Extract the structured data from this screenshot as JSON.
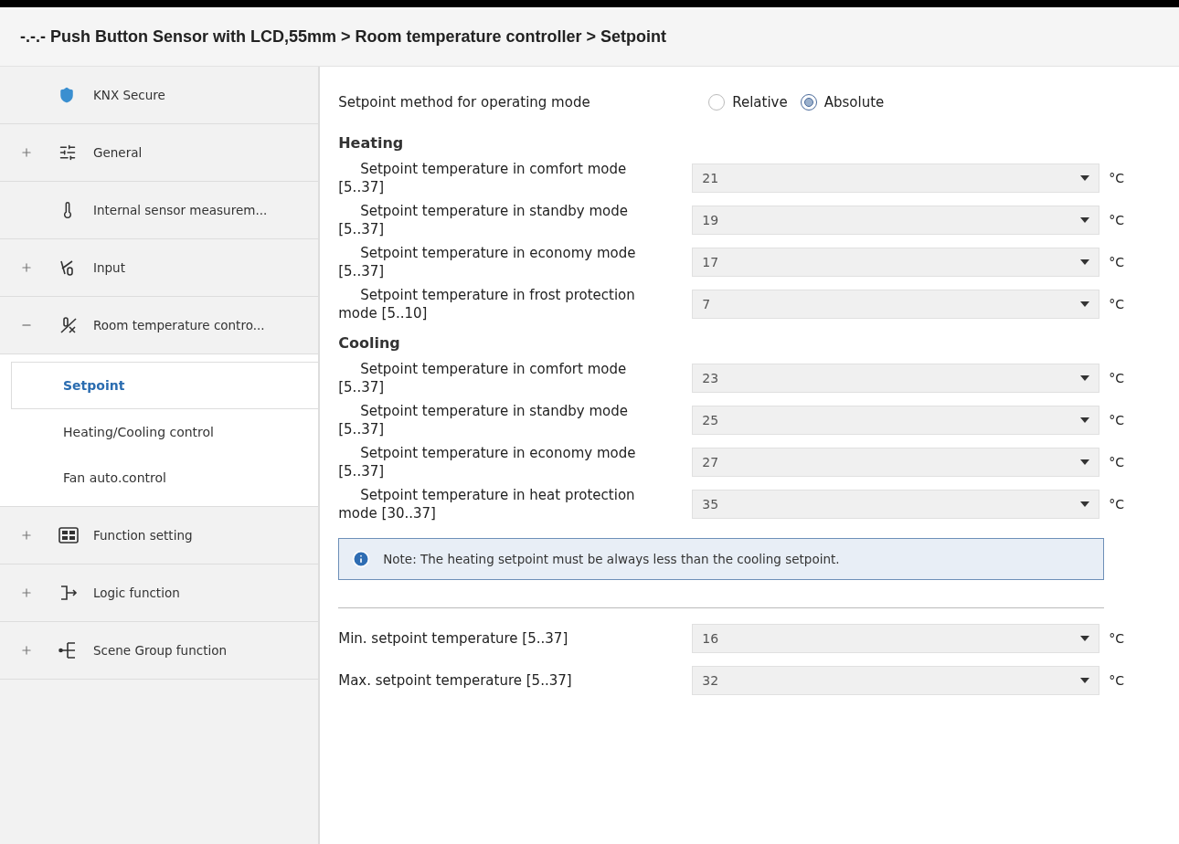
{
  "breadcrumb": "-.-.- Push Button Sensor with LCD,55mm > Room temperature controller > Setpoint",
  "sidebar": {
    "items": [
      {
        "label": "KNX Secure",
        "kind": "leaf"
      },
      {
        "label": "General",
        "kind": "group",
        "expanded": false
      },
      {
        "label": "Internal sensor measurem...",
        "kind": "leaf"
      },
      {
        "label": "Input",
        "kind": "group",
        "expanded": false
      },
      {
        "label": "Room temperature contro...",
        "kind": "group",
        "expanded": true,
        "children": [
          {
            "label": "Setpoint",
            "selected": true
          },
          {
            "label": "Heating/Cooling control",
            "selected": false
          },
          {
            "label": "Fan auto.control",
            "selected": false
          }
        ]
      },
      {
        "label": "Function setting",
        "kind": "group",
        "expanded": false
      },
      {
        "label": "Logic function",
        "kind": "group",
        "expanded": false
      },
      {
        "label": "Scene Group function",
        "kind": "group",
        "expanded": false
      }
    ]
  },
  "method": {
    "label": "Setpoint method for operating mode",
    "options": [
      {
        "label": "Relative",
        "selected": false
      },
      {
        "label": "Absolute",
        "selected": true
      }
    ]
  },
  "sections": [
    {
      "title": "Heating",
      "rows": [
        {
          "label": "Setpoint temperature in comfort mode [5..37]",
          "value": "21",
          "unit": "°C"
        },
        {
          "label": "Setpoint temperature in standby mode [5..37]",
          "value": "19",
          "unit": "°C"
        },
        {
          "label": "Setpoint temperature in economy mode [5..37]",
          "value": "17",
          "unit": "°C"
        },
        {
          "label": "Setpoint temperature in frost protection mode [5..10]",
          "value": "7",
          "unit": "°C"
        }
      ]
    },
    {
      "title": "Cooling",
      "rows": [
        {
          "label": "Setpoint temperature in comfort mode [5..37]",
          "value": "23",
          "unit": "°C"
        },
        {
          "label": "Setpoint temperature in standby mode [5..37]",
          "value": "25",
          "unit": "°C"
        },
        {
          "label": "Setpoint temperature in economy mode [5..37]",
          "value": "27",
          "unit": "°C"
        },
        {
          "label": "Setpoint temperature in heat protection mode [30..37]",
          "value": "35",
          "unit": "°C"
        }
      ]
    }
  ],
  "note": "Note: The heating setpoint must be always less than the cooling setpoint.",
  "limits": [
    {
      "label": "Min. setpoint temperature [5..37]",
      "value": "16",
      "unit": "°C"
    },
    {
      "label": "Max. setpoint temperature [5..37]",
      "value": "32",
      "unit": "°C"
    }
  ]
}
